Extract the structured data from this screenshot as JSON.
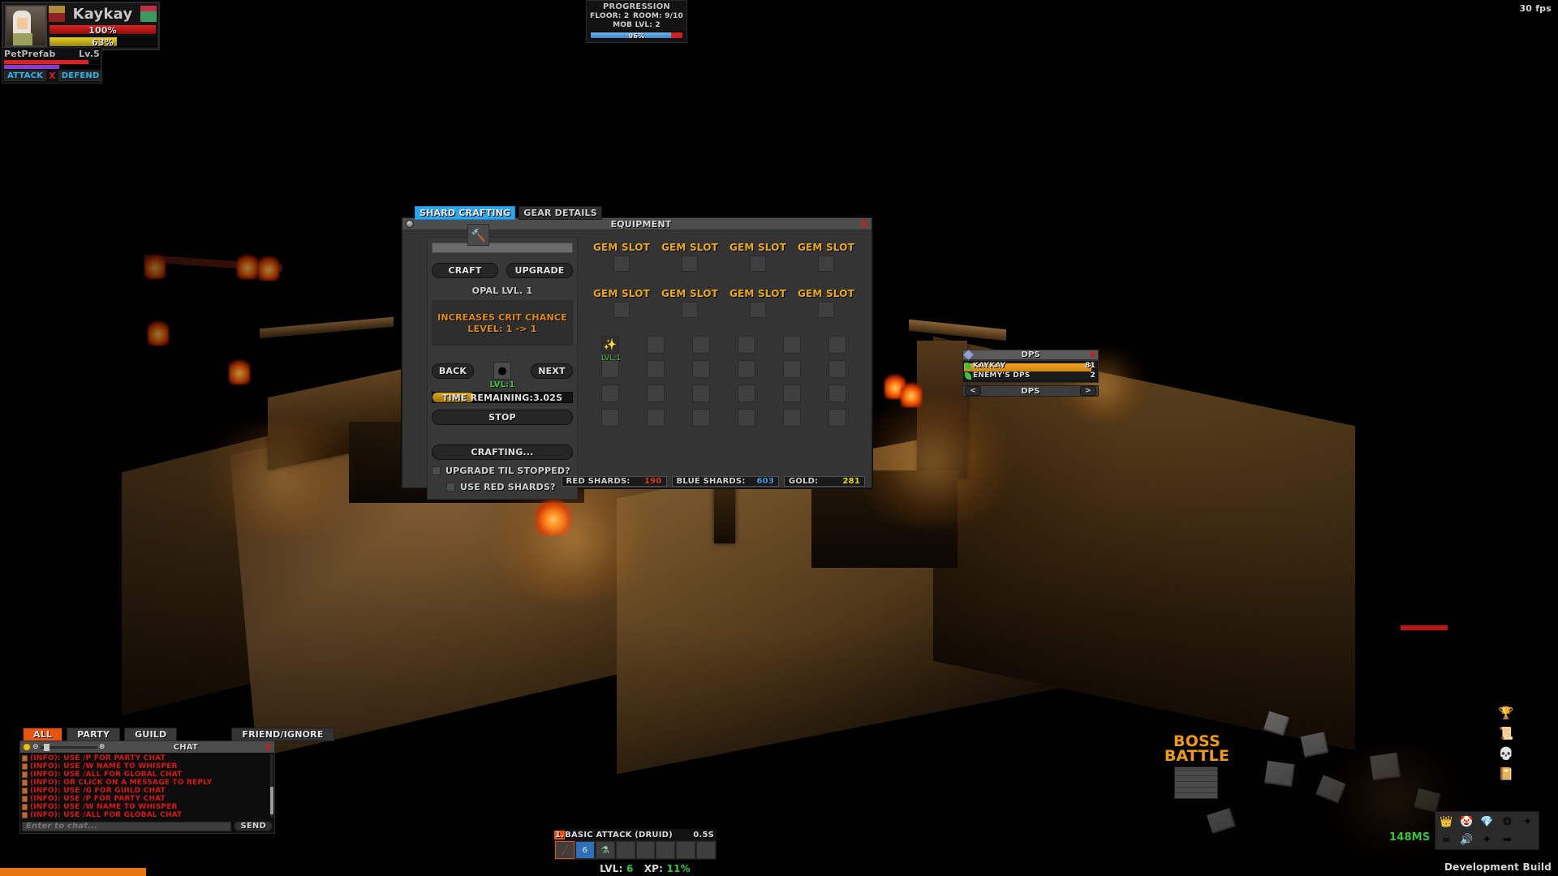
{
  "hud": {
    "player_name": "Kaykay",
    "hp_percent": "100%",
    "xp_percent": "63%",
    "pet_name": "PetPrefab",
    "pet_level": "Lv.5",
    "pet_attack": "ATTACK",
    "pet_cancel": "X",
    "pet_defend": "DEFEND"
  },
  "progression": {
    "title": "PROGRESSION",
    "floor": "FLOOR: 2",
    "room": "ROOM: 9/10",
    "mob_lvl": "MOB LVL: 2",
    "bar_percent": "96%"
  },
  "fps": "30 fps",
  "tabs": [
    {
      "label": "SHARD CRAFTING",
      "active": true
    },
    {
      "label": "GEAR DETAILS",
      "active": false
    }
  ],
  "equipment_window": {
    "title": "EQUIPMENT",
    "close": "X",
    "knob_icon": "window-knob-icon"
  },
  "crafting": {
    "hammer_icon": "hammer-icon",
    "craft_button": "CRAFT",
    "upgrade_button": "UPGRADE",
    "gem_name": "OPAL LVL. 1",
    "desc_line1": "INCREASES CRIT CHANCE",
    "desc_line2": "LEVEL: 1 -> 1",
    "back_button": "BACK",
    "next_button": "NEXT",
    "gem_icon": "opal-gem-icon",
    "gem_level": "LVL:1",
    "time_remaining": "TIME REMAINING:3.02S",
    "stop_button": "STOP",
    "crafting_status": "CRAFTING...",
    "upgrade_til_stopped": "UPGRADE TIL STOPPED?",
    "use_red_shards": "USE RED SHARDS?"
  },
  "gem_slots": [
    "GEM SLOT",
    "GEM SLOT",
    "GEM SLOT",
    "GEM SLOT",
    "GEM SLOT",
    "GEM SLOT",
    "GEM SLOT",
    "GEM SLOT"
  ],
  "inventory": {
    "rows": 4,
    "cols": 6,
    "filled_index": 0,
    "filled_icon": "winged-item-icon",
    "filled_level": "LVL:1"
  },
  "currency": [
    {
      "label": "RED SHARDS:",
      "value": "190",
      "color": "#e03c1c"
    },
    {
      "label": "BLUE SHARDS:",
      "value": "603",
      "color": "#3b9fe0"
    },
    {
      "label": "GOLD:",
      "value": "281",
      "color": "#e8e012"
    }
  ],
  "dps_panel": {
    "title": "DPS",
    "close": "X",
    "rows": [
      {
        "name": "KAYKAY",
        "value": "81",
        "bar_percent": 96
      },
      {
        "name": "ENEMY'S DPS",
        "value": "2",
        "bar_percent": 0
      }
    ],
    "footer_label": "DPS",
    "prev": "<",
    "next": ">"
  },
  "chat": {
    "tabs": [
      {
        "label": "ALL",
        "active": true
      },
      {
        "label": "PARTY",
        "active": false
      },
      {
        "label": "GUILD",
        "active": false
      }
    ],
    "friend_ignore": "FRIEND/IGNORE",
    "title": "CHAT",
    "close": "X",
    "messages": [
      "(INFO): USE /ALL FOR GLOBAL CHAT",
      "(INFO): USE /W NAME TO WHISPER",
      "(INFO): USE /P FOR PARTY CHAT",
      "(INFO): USE /G FOR GUILD CHAT",
      "(INFO): OR CLICK ON A MESSAGE TO REPLY",
      "(INFO): USE /ALL FOR GLOBAL CHAT",
      "(INFO): USE /W NAME TO WHISPER",
      "(INFO): USE /P FOR PARTY CHAT"
    ],
    "input_placeholder": "Enter to chat...",
    "send_button": "SEND"
  },
  "action_bar": {
    "slot_number": "1.",
    "ability_name": "BASIC ATTACK (DRUID)",
    "cooldown": "0.5S",
    "slots": [
      {
        "icon": "sword-icon",
        "selected": true
      },
      {
        "icon": "mana-potion-icon",
        "count": "6",
        "selected": false
      },
      {
        "icon": "health-potion-icon",
        "selected": false
      },
      {
        "icon": "",
        "selected": false
      },
      {
        "icon": "",
        "selected": false
      },
      {
        "icon": "",
        "selected": false
      },
      {
        "icon": "",
        "selected": false
      },
      {
        "icon": "",
        "selected": false
      }
    ],
    "level_label": "LVL:",
    "level_value": "6",
    "xp_label": "XP:",
    "xp_value": "11%"
  },
  "boss": {
    "line1": "BOSS",
    "line2": "BATTLE"
  },
  "ping": "148MS",
  "dev_build": "Development Build",
  "right_icons": [
    "trophy-icon",
    "orb-icon",
    "scroll-icon",
    "map-icon",
    "skull-icon",
    "crossed-weapons-icon",
    "spellbook-icon"
  ],
  "tray_icons": [
    "throne-icon",
    "npc-icon",
    "gems-icon",
    "crystal-icon",
    "shuriken-icon",
    "reaper-icon",
    "sound-icon",
    "star-icon",
    "exit-icon"
  ],
  "colors": {
    "accent_blue": "#2aa6ef",
    "accent_orange": "#e8530f",
    "gold": "#e9a81a",
    "green": "#35c43b",
    "red": "#e01616"
  }
}
